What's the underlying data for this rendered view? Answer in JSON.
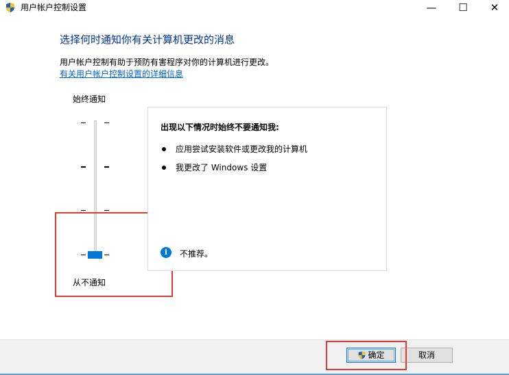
{
  "window": {
    "title": "用户帐户控制设置",
    "minimize_glyph": "—",
    "maximize_glyph": "☐",
    "close_glyph": "✕"
  },
  "main": {
    "heading": "选择何时通知你有关计算机更改的消息",
    "description": "用户帐户控制有助于预防有害程序对你的计算机进行更改。",
    "link": "有关用户帐户控制设置的详细信息"
  },
  "slider": {
    "top_label": "始终通知",
    "bottom_label": "从不通知",
    "level": 0,
    "levels": 4
  },
  "infobox": {
    "title": "出现以下情况时始终不要通知我:",
    "bullets": [
      "应用尝试安装软件或更改我的计算机",
      "我更改了 Windows 设置"
    ],
    "note": "不推荐。",
    "info_icon_glyph": "i"
  },
  "buttons": {
    "ok": "确定",
    "cancel": "取消"
  },
  "colors": {
    "accent": "#0078d7",
    "heading": "#003399",
    "link": "#0066cc",
    "highlight": "#e53935"
  }
}
